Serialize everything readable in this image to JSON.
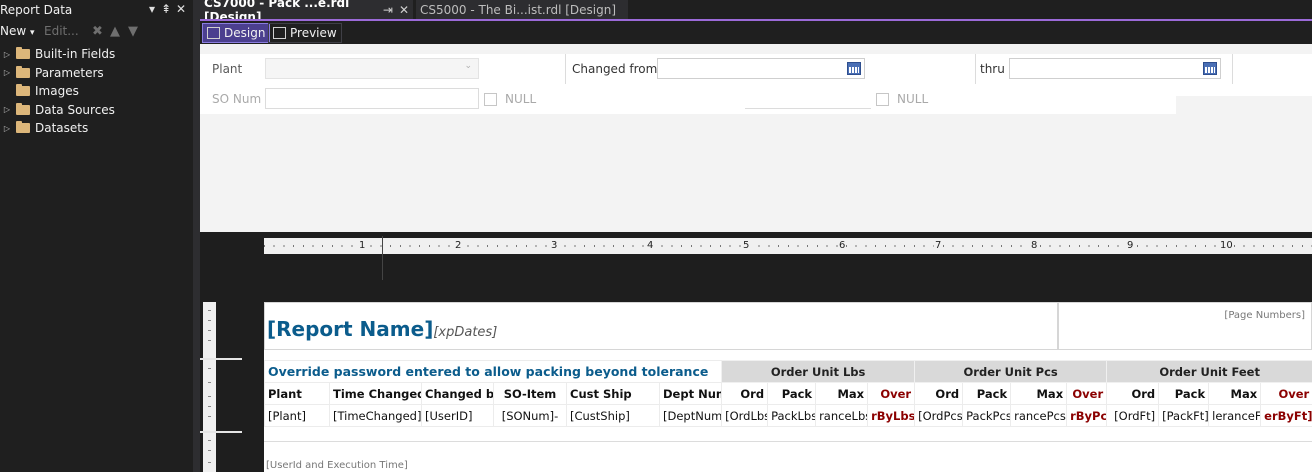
{
  "left_panel": {
    "title": "Report Data",
    "title_buttons": [
      "▾",
      "⇞",
      "✕"
    ],
    "toolbar": {
      "new_label": "New",
      "new_arrow": "▾",
      "edit_label": "Edit..."
    },
    "tree": [
      {
        "label": "Built-in Fields",
        "expandable": true
      },
      {
        "label": "Parameters",
        "expandable": true
      },
      {
        "label": "Images",
        "expandable": false
      },
      {
        "label": "Data Sources",
        "expandable": true
      },
      {
        "label": "Datasets",
        "expandable": true
      }
    ]
  },
  "tabs": {
    "active": {
      "label": "CS7000 - Pack ...e.rdl [Design]",
      "pin": "⇥",
      "close": "✕"
    },
    "inactive": {
      "label": "CS5000 - The Bi...ist.rdl [Design]"
    }
  },
  "view_toolbar": {
    "design_label": "Design",
    "preview_label": "Preview"
  },
  "params": {
    "plant_label": "Plant",
    "changed_from_label": "Changed from",
    "thru_label": "thru",
    "so_num_label": "SO Num",
    "null_label_1": "NULL",
    "null_label_2": "NULL"
  },
  "ruler": {
    "numbers": [
      "1",
      "2",
      "3",
      "4",
      "5",
      "6",
      "7",
      "8",
      "9",
      "10"
    ]
  },
  "report": {
    "title": "[Report Name]",
    "dates": "[xpDates]",
    "page_numbers": "[Page Numbers]",
    "override_text": "Override password entered to allow packing beyond tolerance",
    "groups": {
      "lbs": "Order Unit Lbs",
      "pcs": "Order Unit Pcs",
      "feet": "Order Unit Feet"
    },
    "columns": [
      "Plant",
      "Time Changed",
      "Changed by",
      "SO-Item",
      "Cust Ship",
      "Dept Num",
      "Ord",
      "Pack",
      "Max",
      "Over",
      "Ord",
      "Pack",
      "Max",
      "Over",
      "Ord",
      "Pack",
      "Max",
      "Over"
    ],
    "row": [
      "[Plant]",
      "[TimeChanged]",
      "[UserID]",
      "[SONum]-",
      "[CustShip]",
      "[DeptNum]",
      "[OrdLbs]",
      "PackLbs]",
      "ranceLbs]",
      "rByLbs]",
      "[OrdPcs]",
      "PackPcs]",
      "rancePcs]",
      "rByPcs]",
      "[OrdFt]",
      "[PackFt]",
      "leranceFt]",
      "erByFt]"
    ],
    "footer": "[UserId and Execution Time]"
  }
}
